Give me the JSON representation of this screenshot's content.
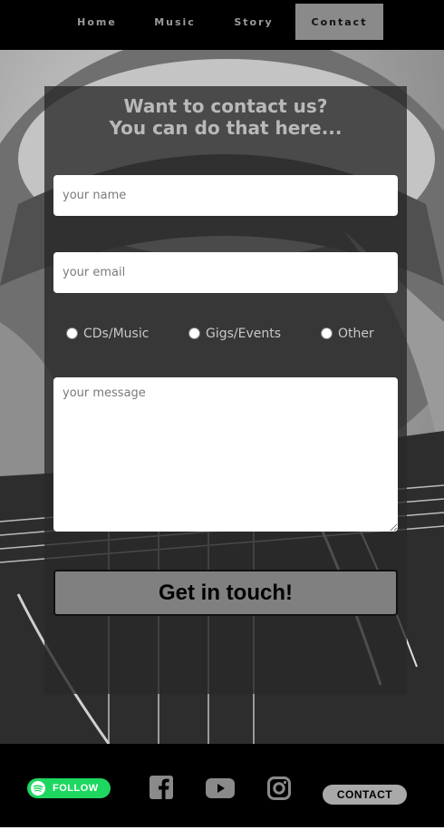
{
  "nav": {
    "items": [
      {
        "label": "Home"
      },
      {
        "label": "Music"
      },
      {
        "label": "Story"
      },
      {
        "label": "Contact",
        "active": true
      }
    ]
  },
  "form": {
    "heading_line1": "Want to contact us?",
    "heading_line2": "You can do that here...",
    "name_placeholder": "your name",
    "email_placeholder": "your email",
    "radios": [
      {
        "label": "CDs/Music",
        "checked": false
      },
      {
        "label": "Gigs/Events",
        "checked": false
      },
      {
        "label": "Other",
        "checked": false
      }
    ],
    "message_placeholder": "your message",
    "submit_label": "Get in touch!"
  },
  "footer": {
    "spotify_label": "FOLLOW",
    "social_icons": [
      "facebook-icon",
      "youtube-icon",
      "instagram-icon"
    ],
    "contact_label": "CONTACT"
  },
  "colors": {
    "nav_bg": "#000000",
    "active_tab": "#8a8a8a",
    "spotify_green": "#1ed760",
    "button_gray": "#808080"
  }
}
